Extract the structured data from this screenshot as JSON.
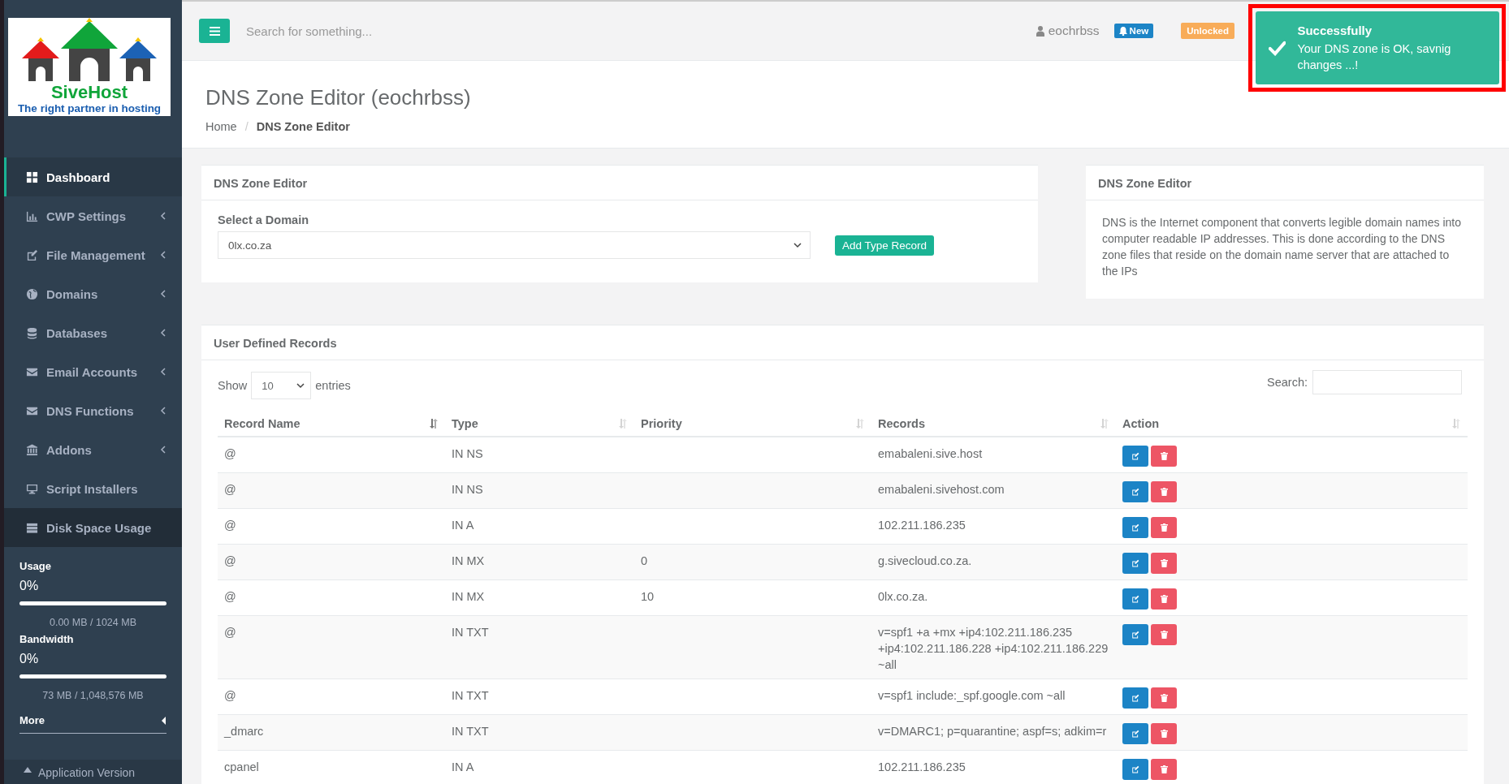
{
  "logo": {
    "name": "SiveHost",
    "tagline": "The right partner in hosting"
  },
  "sidebar": {
    "items": [
      {
        "label": "Dashboard",
        "selected": true,
        "hovered": false,
        "submenu": false
      },
      {
        "label": "CWP Settings",
        "selected": false,
        "hovered": false,
        "submenu": true
      },
      {
        "label": "File Management",
        "selected": false,
        "hovered": false,
        "submenu": true
      },
      {
        "label": "Domains",
        "selected": false,
        "hovered": false,
        "submenu": true
      },
      {
        "label": "Databases",
        "selected": false,
        "hovered": false,
        "submenu": true
      },
      {
        "label": "Email Accounts",
        "selected": false,
        "hovered": false,
        "submenu": true
      },
      {
        "label": "DNS Functions",
        "selected": false,
        "hovered": false,
        "submenu": true
      },
      {
        "label": "Addons",
        "selected": false,
        "hovered": false,
        "submenu": true
      },
      {
        "label": "Script Installers",
        "selected": false,
        "hovered": false,
        "submenu": false
      },
      {
        "label": "Disk Space Usage",
        "selected": false,
        "hovered": true,
        "submenu": false
      }
    ],
    "meters": [
      {
        "title": "Usage",
        "percent": "0%",
        "level": 0,
        "detail": "0.00 MB / 1024 MB"
      },
      {
        "title": "Bandwidth",
        "percent": "0%",
        "level": 0,
        "detail": "73 MB / 1,048,576 MB"
      }
    ],
    "more": "More",
    "app_version": "Application Version"
  },
  "topbar": {
    "search_placeholder": "Search for something...",
    "user": "eochrbss",
    "new_badge": "New",
    "status_badge": "Unlocked"
  },
  "toast": {
    "title": "Successfully",
    "message": "Your DNS zone is OK, savnig changes ...!"
  },
  "page": {
    "title": "DNS Zone Editor (eochrbss)",
    "breadcrumb": [
      "Home",
      "DNS Zone Editor"
    ],
    "breadcrumb_separator": "/"
  },
  "zone_card": {
    "title": "DNS Zone Editor",
    "field_label": "Select a Domain",
    "domain": "0lx.co.za",
    "button": "Add Type Record"
  },
  "info_card": {
    "title": "DNS Zone Editor",
    "text": "DNS is the Internet component that converts legible domain names into computer readable IP addresses. This is done according to the DNS zone files that reside on the domain name server that are attached to the IPs"
  },
  "records": {
    "title": "User Defined Records",
    "show_label": "Show",
    "page_size": "10",
    "entries_label": "entries",
    "search_label": "Search:",
    "columns": [
      {
        "label": "Record Name",
        "sorted": true
      },
      {
        "label": "Type",
        "sorted": false
      },
      {
        "label": "Priority",
        "sorted": false
      },
      {
        "label": "Records",
        "sorted": false
      },
      {
        "label": "Action",
        "sorted": false
      }
    ],
    "rows": [
      {
        "name": "@",
        "type": "IN NS",
        "records": "emabaleni.sive.host"
      },
      {
        "name": "@",
        "type": "IN NS",
        "records": "emabaleni.sivehost.com"
      },
      {
        "name": "@",
        "type": "IN A",
        "records": "102.211.186.235"
      },
      {
        "name": "@",
        "type": "IN MX",
        "priority": "0",
        "records": "g.sivecloud.co.za."
      },
      {
        "name": "@",
        "type": "IN MX",
        "priority": "10",
        "records": "0lx.co.za."
      },
      {
        "name": "@",
        "type": "IN TXT",
        "records": "v=spf1 +a +mx +ip4:102.211.186.235 +ip4:102.211.186.228 +ip4:102.211.186.229 ~all"
      },
      {
        "name": "@",
        "type": "IN TXT",
        "records": "v=spf1 include:_spf.google.com ~all"
      },
      {
        "name": "_dmarc",
        "type": "IN TXT",
        "records": "v=DMARC1; p=quarantine; aspf=s; adkim=r"
      },
      {
        "name": "cpanel",
        "type": "IN A",
        "records": "102.211.186.235"
      }
    ]
  }
}
